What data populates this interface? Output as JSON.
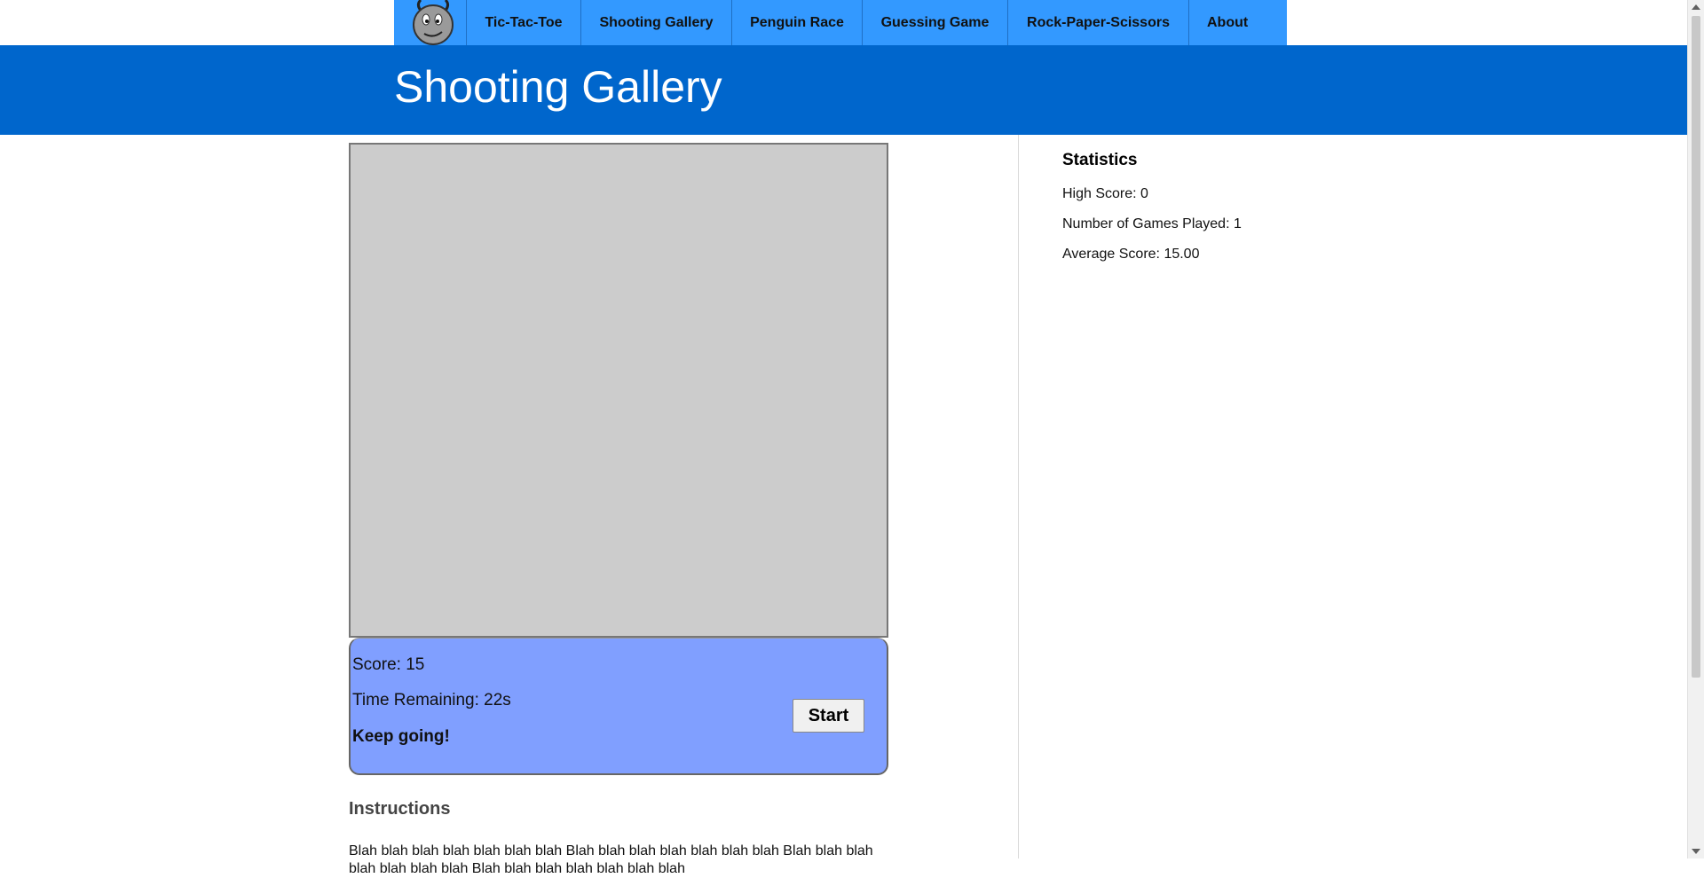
{
  "nav": {
    "logo_icon": "cartoon-face-logo-icon",
    "items": [
      {
        "label": "Tic-Tac-Toe"
      },
      {
        "label": "Shooting Gallery"
      },
      {
        "label": "Penguin Race"
      },
      {
        "label": "Guessing Game"
      },
      {
        "label": "Rock-Paper-Scissors"
      },
      {
        "label": "About"
      }
    ]
  },
  "banner": {
    "title": "Shooting Gallery"
  },
  "game": {
    "score": "Score: 15",
    "time": "Time Remaining: 22s",
    "message": "Keep going!",
    "start_label": "Start"
  },
  "instructions": {
    "title": "Instructions",
    "text": "Blah blah blah blah blah blah blah Blah blah blah blah blah blah blah Blah blah blah blah blah blah blah Blah blah blah blah blah blah blah"
  },
  "stats": {
    "title": "Statistics",
    "high_score": "High Score: 0",
    "games_played": "Number of Games Played: 1",
    "average_score": "Average Score: 15.00"
  },
  "colors": {
    "nav_bg": "#3399ff",
    "banner_bg": "#0066cc",
    "canvas_bg": "#cccccc",
    "panel_bg": "#809fff"
  }
}
